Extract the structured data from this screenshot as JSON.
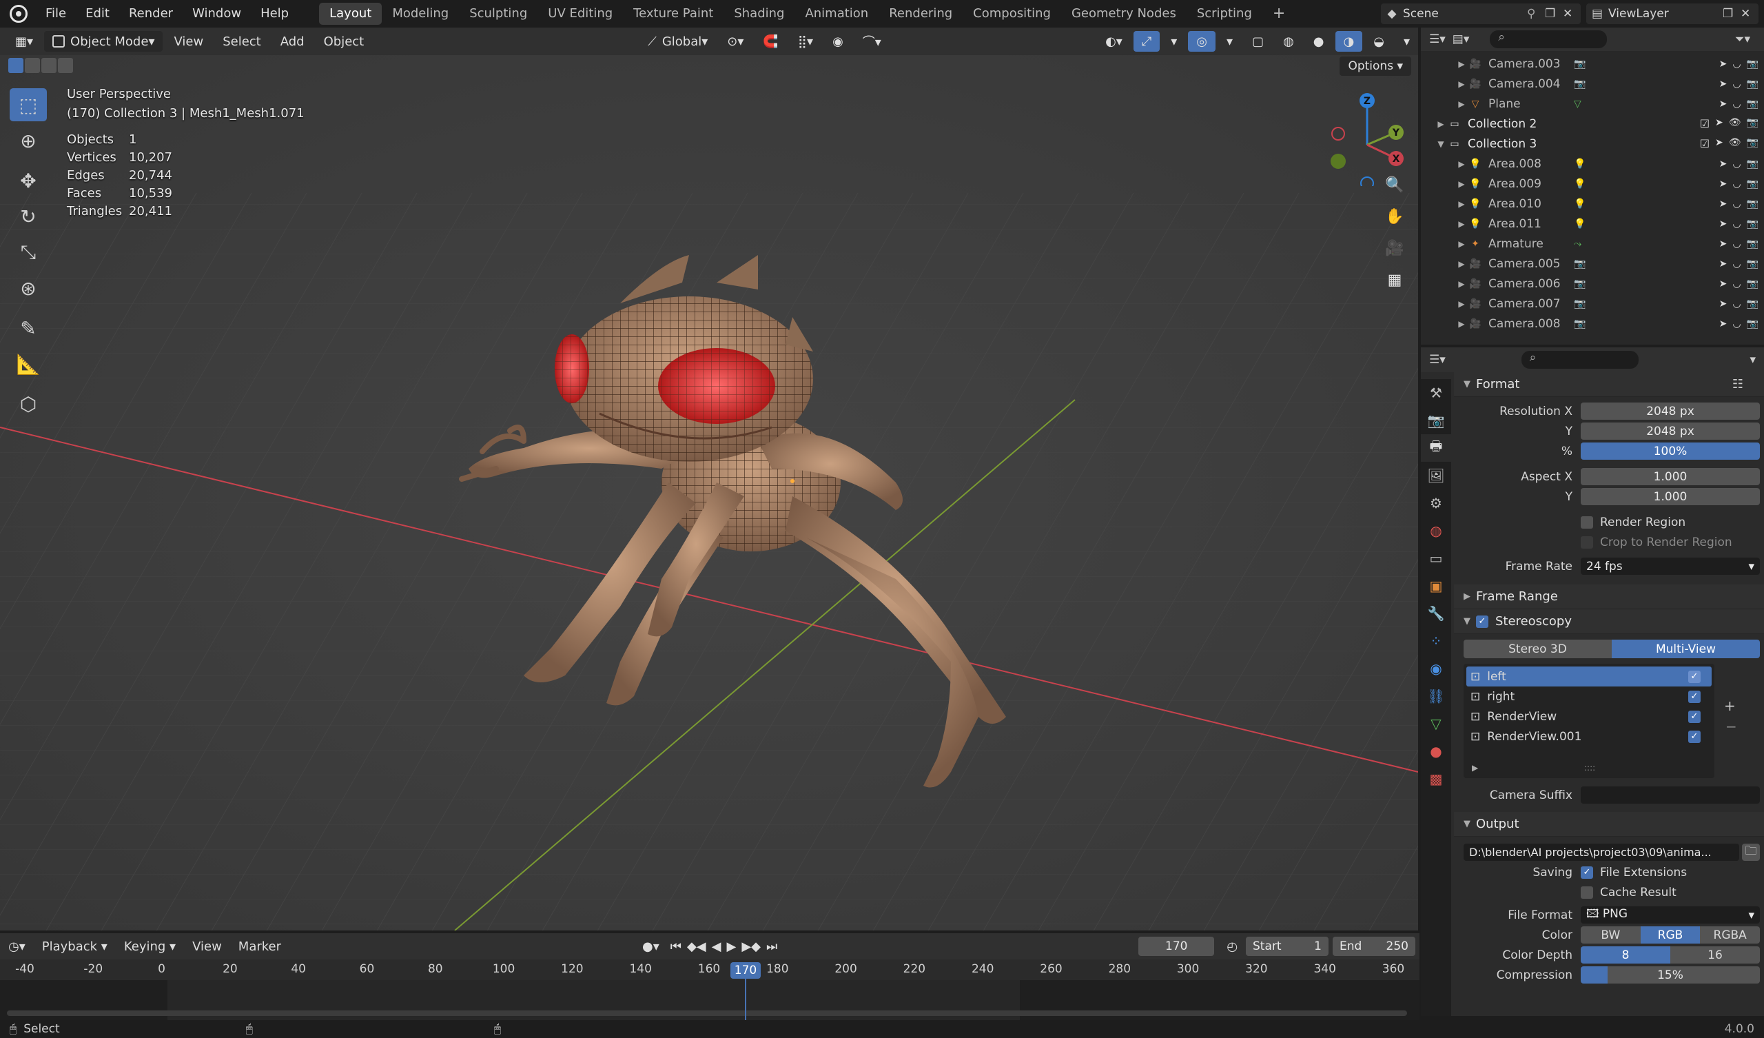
{
  "topbar": {
    "menus": [
      "File",
      "Edit",
      "Render",
      "Window",
      "Help"
    ],
    "workspaces": [
      "Layout",
      "Modeling",
      "Sculpting",
      "UV Editing",
      "Texture Paint",
      "Shading",
      "Animation",
      "Rendering",
      "Compositing",
      "Geometry Nodes",
      "Scripting"
    ],
    "active_workspace": "Layout",
    "scene": "Scene",
    "view_layer": "ViewLayer"
  },
  "viewport_header": {
    "mode": "Object Mode",
    "menus": [
      "View",
      "Select",
      "Add",
      "Object"
    ],
    "orientation": "Global",
    "options": "Options"
  },
  "viewport_overlay": {
    "perspective": "User Perspective",
    "context": "(170) Collection 3 | Mesh1_Mesh1.071",
    "stats": [
      {
        "k": "Objects",
        "v": "1"
      },
      {
        "k": "Vertices",
        "v": "10,207"
      },
      {
        "k": "Edges",
        "v": "20,744"
      },
      {
        "k": "Faces",
        "v": "10,539"
      },
      {
        "k": "Triangles",
        "v": "20,411"
      }
    ],
    "gizmo": {
      "x": "X",
      "y": "Y",
      "z": "Z"
    }
  },
  "outliner": {
    "rows": [
      {
        "name": "Camera.003",
        "indent": 2,
        "type": "camera"
      },
      {
        "name": "Camera.004",
        "indent": 2,
        "type": "camera"
      },
      {
        "name": "Plane",
        "indent": 2,
        "type": "mesh"
      },
      {
        "name": "Collection 2",
        "indent": 1,
        "type": "collection"
      },
      {
        "name": "Collection 3",
        "indent": 1,
        "type": "collection",
        "expanded": true
      },
      {
        "name": "Area.008",
        "indent": 2,
        "type": "light"
      },
      {
        "name": "Area.009",
        "indent": 2,
        "type": "light"
      },
      {
        "name": "Area.010",
        "indent": 2,
        "type": "light"
      },
      {
        "name": "Area.011",
        "indent": 2,
        "type": "light"
      },
      {
        "name": "Armature",
        "indent": 2,
        "type": "armature"
      },
      {
        "name": "Camera.005",
        "indent": 2,
        "type": "camera"
      },
      {
        "name": "Camera.006",
        "indent": 2,
        "type": "camera"
      },
      {
        "name": "Camera.007",
        "indent": 2,
        "type": "camera"
      },
      {
        "name": "Camera.008",
        "indent": 2,
        "type": "camera"
      }
    ]
  },
  "properties": {
    "format_title": "Format",
    "resolution_x_label": "Resolution X",
    "resolution_x": "2048 px",
    "y_label": "Y",
    "resolution_y": "2048 px",
    "pct_label": "%",
    "resolution_pct": "100%",
    "aspect_x_label": "Aspect X",
    "aspect_x": "1.000",
    "aspect_y": "1.000",
    "render_region": "Render Region",
    "crop_region": "Crop to Render Region",
    "frame_rate_label": "Frame Rate",
    "frame_rate": "24 fps",
    "frame_range_title": "Frame Range",
    "stereoscopy_title": "Stereoscopy",
    "stereo_modes": [
      "Stereo 3D",
      "Multi-View"
    ],
    "views": [
      "left",
      "right",
      "RenderView",
      "RenderView.001"
    ],
    "camera_suffix_label": "Camera Suffix",
    "output_title": "Output",
    "output_path": "D:\\blender\\AI projects\\project03\\09\\anima...",
    "saving_label": "Saving",
    "file_extensions": "File Extensions",
    "cache_result": "Cache Result",
    "file_format_label": "File Format",
    "file_format": "PNG",
    "color_label": "Color",
    "color_modes": [
      "BW",
      "RGB",
      "RGBA"
    ],
    "color_depth_label": "Color Depth",
    "color_depths": [
      "8",
      "16"
    ],
    "compression_label": "Compression",
    "compression": "15%"
  },
  "timeline": {
    "menus": [
      "Playback",
      "Keying",
      "View",
      "Marker"
    ],
    "current_frame": "170",
    "start_label": "Start",
    "start": "1",
    "end_label": "End",
    "end": "250",
    "ticks": [
      "-40",
      "-20",
      "0",
      "20",
      "40",
      "60",
      "80",
      "100",
      "120",
      "140",
      "160",
      "180",
      "200",
      "220",
      "240",
      "260",
      "280",
      "300",
      "320",
      "340",
      "360"
    ],
    "playhead": "170"
  },
  "statusbar": {
    "left": "Select",
    "version": "4.0.0"
  },
  "colors": {
    "accent": "#4772b3",
    "x_axis": "#c8424d",
    "y_axis": "#7a9a32",
    "z_axis": "#2d7fd8"
  }
}
